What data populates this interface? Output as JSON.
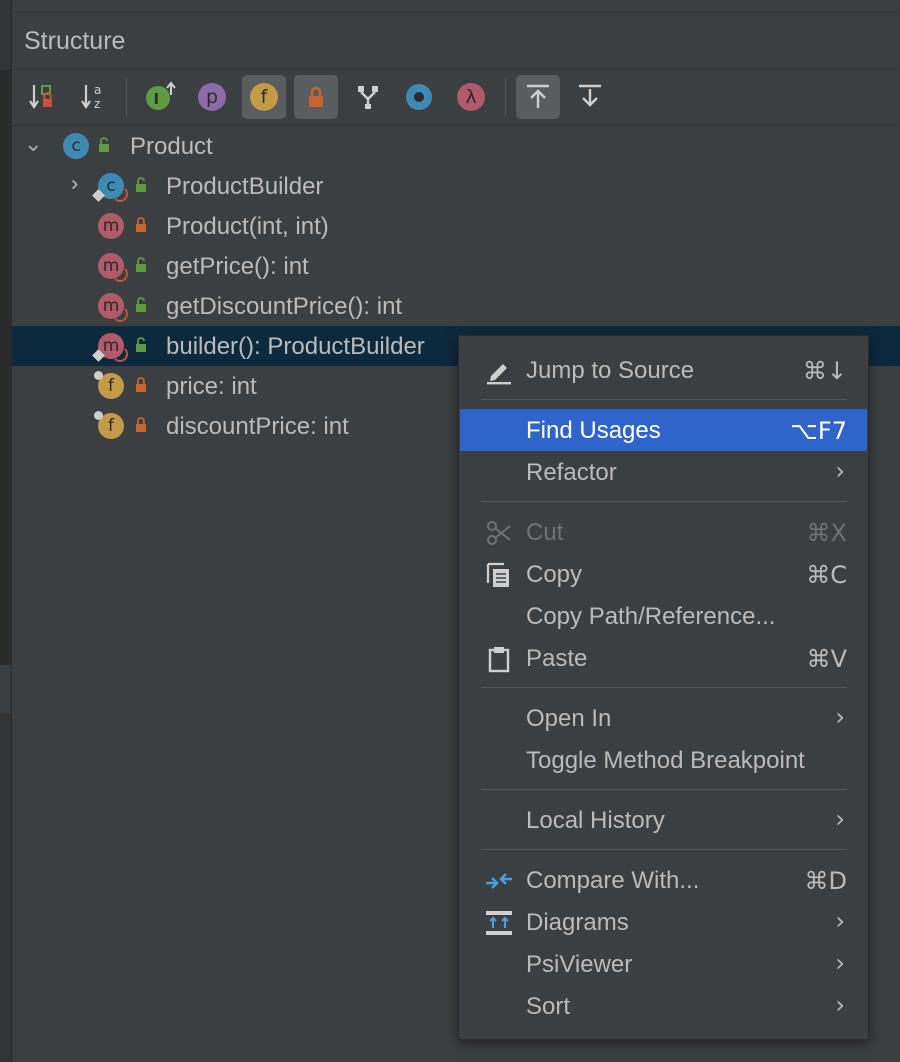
{
  "panel": {
    "title": "Structure"
  },
  "toolbar": {
    "buttons": [
      {
        "name": "sort-by-visibility-icon",
        "active": false
      },
      {
        "name": "sort-alphabetically-icon",
        "active": false
      },
      {
        "name": "show-inherited-icon",
        "glyph": "I",
        "active": false
      },
      {
        "name": "show-properties-icon",
        "glyph": "p",
        "active": false
      },
      {
        "name": "show-fields-icon",
        "glyph": "f",
        "active": true
      },
      {
        "name": "show-non-public-icon",
        "active": true
      },
      {
        "name": "group-icon",
        "active": false
      },
      {
        "name": "show-anonymous-icon",
        "active": false
      },
      {
        "name": "show-lambdas-icon",
        "glyph": "λ",
        "active": false
      },
      {
        "name": "autoscroll-to-source-icon",
        "active": true
      },
      {
        "name": "autoscroll-from-source-icon",
        "active": false
      }
    ]
  },
  "tree": [
    {
      "label": "Product",
      "kind": "class",
      "glyph": "c"
    },
    {
      "label": "ProductBuilder",
      "kind": "class",
      "glyph": "c"
    },
    {
      "label": "Product(int, int)",
      "kind": "method",
      "glyph": "m"
    },
    {
      "label": "getPrice(): int",
      "kind": "method",
      "glyph": "m"
    },
    {
      "label": "getDiscountPrice(): int",
      "kind": "method",
      "glyph": "m"
    },
    {
      "label": "builder(): ProductBuilder",
      "kind": "method",
      "glyph": "m",
      "selected": true
    },
    {
      "label": "price: int",
      "kind": "field",
      "glyph": "f"
    },
    {
      "label": "discountPrice: int",
      "kind": "field",
      "glyph": "f"
    }
  ],
  "menu": {
    "items": [
      {
        "label": "Jump to Source",
        "shortcut": "⌘↓",
        "icon": "pencil-icon"
      },
      {
        "label": "Find Usages",
        "shortcut": "⌥F7",
        "highlighted": true
      },
      {
        "label": "Refactor",
        "submenu": true
      },
      {
        "label": "Cut",
        "shortcut": "⌘X",
        "icon": "scissors-icon",
        "disabled": true
      },
      {
        "label": "Copy",
        "shortcut": "⌘C",
        "icon": "copy-icon"
      },
      {
        "label": "Copy Path/Reference..."
      },
      {
        "label": "Paste",
        "shortcut": "⌘V",
        "icon": "clipboard-icon"
      },
      {
        "label": "Open In",
        "submenu": true
      },
      {
        "label": "Toggle Method Breakpoint"
      },
      {
        "label": "Local History",
        "submenu": true
      },
      {
        "label": "Compare With...",
        "shortcut": "⌘D",
        "icon": "compare-icon"
      },
      {
        "label": "Diagrams",
        "submenu": true,
        "icon": "diagram-icon"
      },
      {
        "label": "PsiViewer",
        "submenu": true
      },
      {
        "label": "Sort",
        "submenu": true
      }
    ],
    "submenu_arrow": "›"
  },
  "colors": {
    "background": "#3c3f41",
    "selection": "#0d293e",
    "highlight": "#2f65ca",
    "class_icon": "#3d8ab2",
    "method_icon": "#b15a6a",
    "field_icon": "#c39a47",
    "lock_red": "#c7652e",
    "lock_green": "#5e9c3f"
  }
}
